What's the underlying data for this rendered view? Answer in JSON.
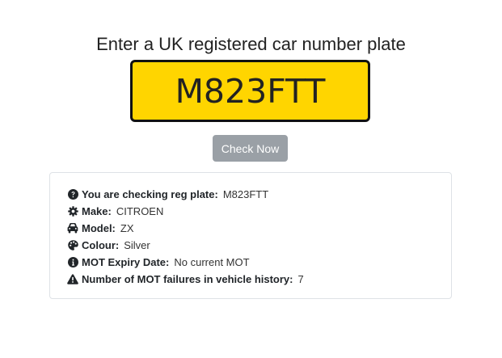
{
  "heading": "Enter a UK registered car number plate",
  "plate": {
    "value": "M823FTT",
    "background_color": "#ffd500"
  },
  "check_button": {
    "label": "Check Now"
  },
  "results": [
    {
      "icon": "question-circle-icon",
      "label": "You are checking reg plate:",
      "value": "M823FTT"
    },
    {
      "icon": "cog-icon",
      "label": "Make:",
      "value": "CITROEN"
    },
    {
      "icon": "car-icon",
      "label": "Model:",
      "value": "ZX"
    },
    {
      "icon": "palette-icon",
      "label": "Colour:",
      "value": "Silver"
    },
    {
      "icon": "info-circle-icon",
      "label": "MOT Expiry Date:",
      "value": "No current MOT"
    },
    {
      "icon": "warning-triangle-icon",
      "label": "Number of MOT failures in vehicle history:",
      "value": "7"
    }
  ]
}
